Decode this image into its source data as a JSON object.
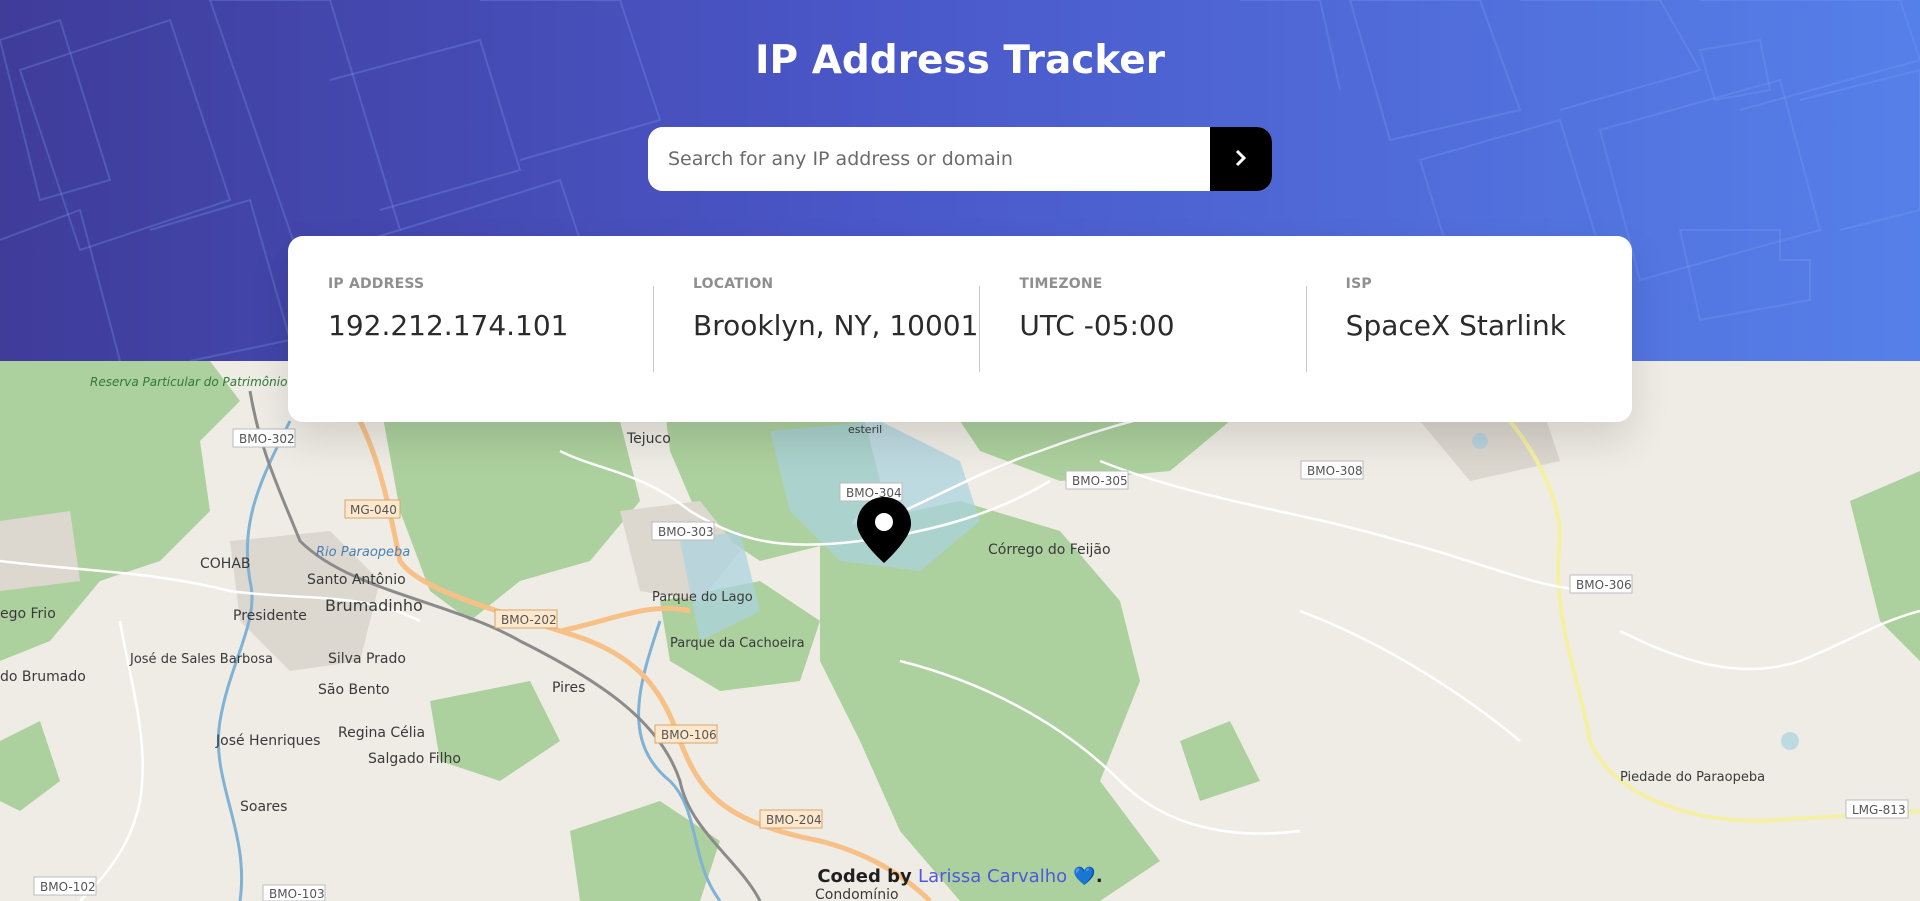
{
  "header": {
    "title": "IP Address Tracker",
    "search_placeholder": "Search for any IP address or domain",
    "submit_icon": "chevron-right-icon"
  },
  "info": {
    "ip": {
      "label": "IP ADDRESS",
      "value": "192.212.174.101"
    },
    "location": {
      "label": "LOCATION",
      "value": "Brooklyn, NY, 10001"
    },
    "timezone": {
      "label": "TIMEZONE",
      "value": "UTC -05:00"
    },
    "isp": {
      "label": "ISP",
      "value": "SpaceX Starlink"
    }
  },
  "map": {
    "marker_icon": "location-pin-icon",
    "place_labels": [
      "Reserva Particular do Patrimônio Natural Inhotim",
      "Tejuco",
      "Córrego do Feijão",
      "COHAB",
      "Santo Antônio",
      "Brumadinho",
      "Presidente",
      "Silva Prado",
      "São Bento",
      "José de Sales Barbosa",
      "Regina Célia",
      "Salgado Filho",
      "José Henriques",
      "Soares",
      "Parque do Lago",
      "Parque da Cachoeira",
      "Pires",
      "Piedade do Paraopeba",
      "Rio Paraopeba",
      "ego Frio",
      "do Brumado",
      "Condomínio",
      "esteril"
    ],
    "road_labels": [
      "BMO-302",
      "MG-040",
      "BMO-304",
      "BMO-303",
      "BMO-305",
      "BMO-308",
      "BMO-202",
      "BMO-106",
      "BMO-204",
      "BMO-306",
      "LMG-813",
      "BMO-102",
      "BMO-103"
    ]
  },
  "footer": {
    "prefix": "Coded by",
    "author": "Larissa Carvalho",
    "heart": "💙",
    "suffix": "."
  },
  "colors": {
    "header_start": "#3f3c9a",
    "header_end": "#5680e9",
    "button": "#000000",
    "link": "#4e5ad8"
  }
}
